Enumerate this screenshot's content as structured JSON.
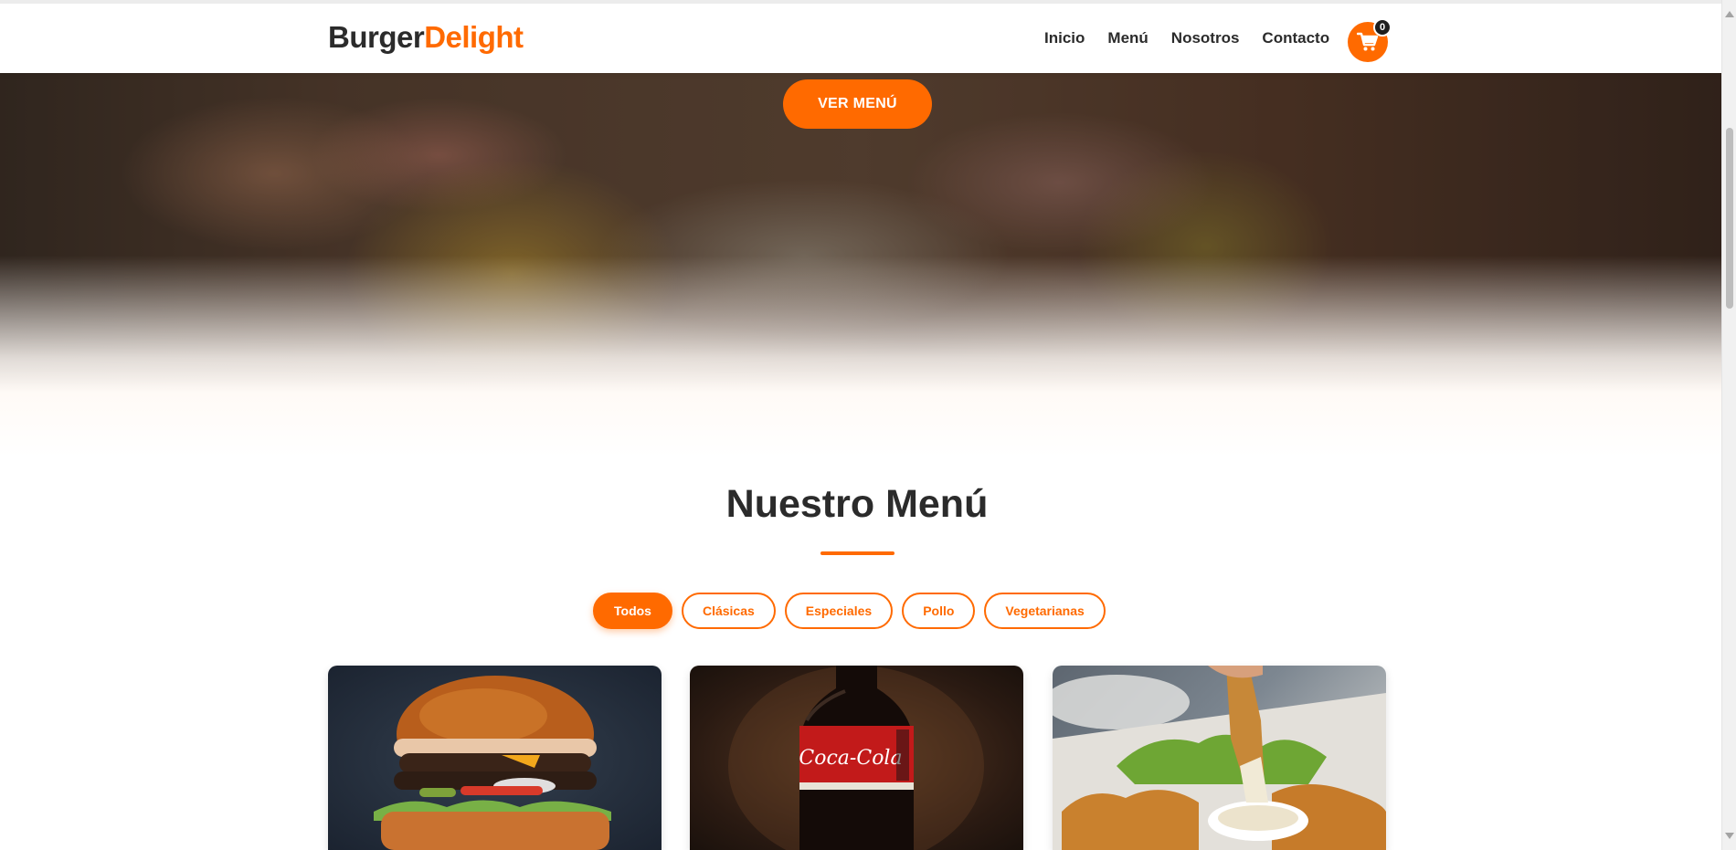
{
  "header": {
    "logo_part1": "Burger",
    "logo_part2": "Delight",
    "nav": [
      "Inicio",
      "Menú",
      "Nosotros",
      "Contacto"
    ],
    "cart_count": "0",
    "cart_icon": "shopping-cart-icon"
  },
  "hero": {
    "cta_label": "VER MENÚ"
  },
  "menu": {
    "title": "Nuestro Menú",
    "filters": [
      {
        "label": "Todos",
        "active": true
      },
      {
        "label": "Clásicas",
        "active": false
      },
      {
        "label": "Especiales",
        "active": false
      },
      {
        "label": "Pollo",
        "active": false
      },
      {
        "label": "Vegetarianas",
        "active": false
      }
    ],
    "cards": [
      {
        "image": "burger-photo"
      },
      {
        "image": "coca-cola-bottle-photo",
        "brand_text": "Coca-Cola"
      },
      {
        "image": "chicken-tenders-photo"
      }
    ]
  },
  "colors": {
    "accent": "#ff6a00",
    "text_dark": "#2b2b2b",
    "background": "#ffffff"
  }
}
